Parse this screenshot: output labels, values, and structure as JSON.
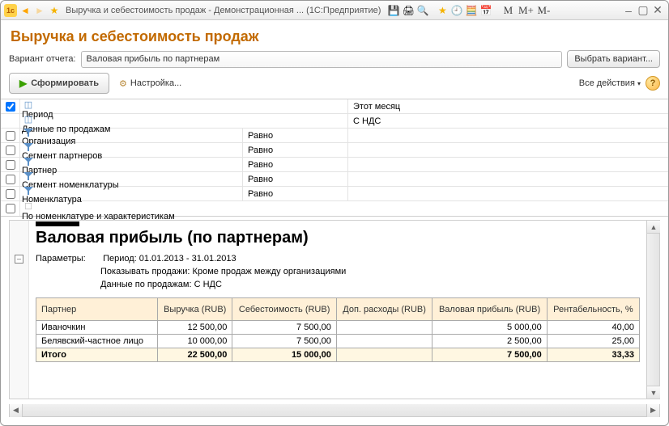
{
  "window": {
    "title": "Выручка и себестоимость продаж - Демонстрационная ... (1С:Предприятие)"
  },
  "header": {
    "title": "Выручка и себестоимость продаж"
  },
  "variant": {
    "label": "Вариант отчета:",
    "value": "Валовая прибыль по партнерам",
    "choose": "Выбрать вариант..."
  },
  "toolbar": {
    "generate": "Сформировать",
    "settings": "Настройка...",
    "all_actions": "Все действия"
  },
  "params": [
    {
      "checked": true,
      "type": "period",
      "label": "Период",
      "value": "Этот месяц"
    },
    {
      "checked": null,
      "type": "data",
      "label": "Данные по продажам",
      "value": "С НДС"
    },
    {
      "checked": false,
      "type": "filter",
      "label": "Организация",
      "op": "Равно",
      "value": ""
    },
    {
      "checked": false,
      "type": "filter",
      "label": "Сегмент партнеров",
      "op": "Равно",
      "value": ""
    },
    {
      "checked": false,
      "type": "filter",
      "label": "Партнер",
      "op": "Равно",
      "value": ""
    },
    {
      "checked": false,
      "type": "filter",
      "label": "Сегмент номенклатуры",
      "op": "Равно",
      "value": ""
    },
    {
      "checked": false,
      "type": "filter",
      "label": "Номенклатура",
      "op": "Равно",
      "value": ""
    },
    {
      "checked": false,
      "type": "flag",
      "label": "По номенклатуре и характеристикам",
      "value": ""
    }
  ],
  "report": {
    "title": "Валовая прибыль (по партнерам)",
    "params_label": "Параметры:",
    "p_period": "Период: 01.01.2013 - 31.01.2013",
    "p_show": "Показывать продажи: Кроме продаж между организациями",
    "p_data": "Данные по продажам: С НДС",
    "columns": [
      "Партнер",
      "Выручка (RUB)",
      "Себестоимость (RUB)",
      "Доп. расходы (RUB)",
      "Валовая прибыль (RUB)",
      "Рентабельность, %"
    ],
    "rows": [
      {
        "partner": "Иваночкин",
        "revenue": "12 500,00",
        "cost": "7 500,00",
        "extra": "",
        "profit": "5 000,00",
        "margin": "40,00"
      },
      {
        "partner": "Белявский-частное лицо",
        "revenue": "10 000,00",
        "cost": "7 500,00",
        "extra": "",
        "profit": "2 500,00",
        "margin": "25,00"
      }
    ],
    "total": {
      "partner": "Итого",
      "revenue": "22 500,00",
      "cost": "15 000,00",
      "extra": "",
      "profit": "7 500,00",
      "margin": "33,33"
    }
  }
}
